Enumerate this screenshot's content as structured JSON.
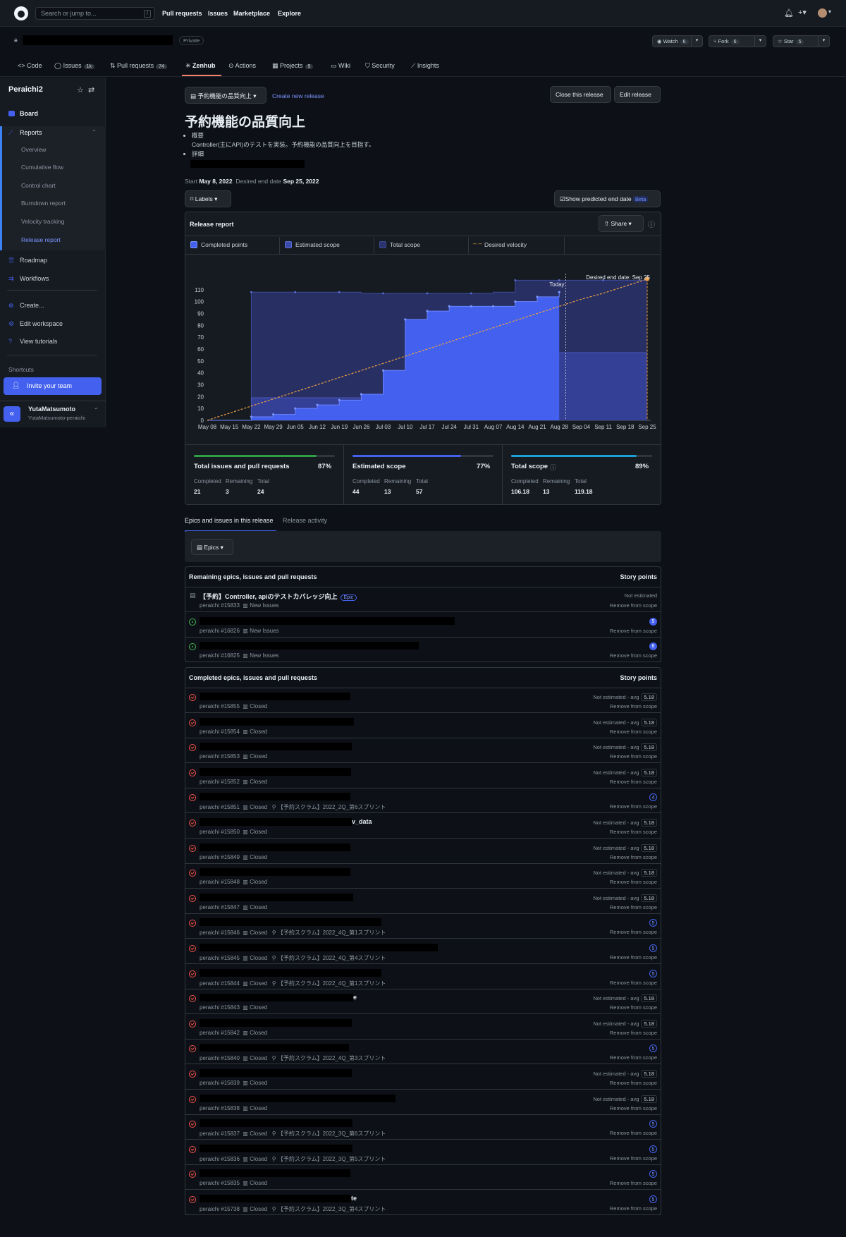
{
  "topnav": {
    "search_placeholder": "Search or jump to...",
    "slash_key": "/",
    "links": [
      "Pull requests",
      "Issues",
      "Marketplace",
      "Explore"
    ]
  },
  "repo": {
    "private_label": "Private",
    "watch": {
      "label": "Watch",
      "count": "6"
    },
    "fork": {
      "label": "Fork",
      "count": "6"
    },
    "star": {
      "label": "Star",
      "count": "5"
    }
  },
  "tabs": [
    {
      "label": "Code",
      "count": ""
    },
    {
      "label": "Issues",
      "count": "1k"
    },
    {
      "label": "Pull requests",
      "count": "74"
    },
    {
      "label": "Zenhub",
      "count": ""
    },
    {
      "label": "Actions",
      "count": ""
    },
    {
      "label": "Projects",
      "count": "9"
    },
    {
      "label": "Wiki",
      "count": ""
    },
    {
      "label": "Security",
      "count": ""
    },
    {
      "label": "Insights",
      "count": ""
    }
  ],
  "sidebar": {
    "workspace": "Peraichi2",
    "items": {
      "board": "Board",
      "reports": "Reports",
      "roadmap": "Roadmap",
      "workflows": "Workflows",
      "create": "Create...",
      "edit_workspace": "Edit workspace",
      "view_tutorials": "View tutorials"
    },
    "report_items": [
      "Overview",
      "Cumulative flow",
      "Control chart",
      "Burndown report",
      "Velocity tracking",
      "Release report"
    ],
    "shortcuts": "Shortcuts",
    "invite": "Invite your team",
    "user": {
      "name": "YutaMatsumoto",
      "login": "YutaMatsumoto-peraichi"
    }
  },
  "release": {
    "selector": "予約機能の品質向上",
    "create_new": "Create new release",
    "close_btn": "Close this release",
    "edit_btn": "Edit release",
    "title": "予約機能の品質向上",
    "bullet1": "概要",
    "bullet1_text": "Controller(主にAPI)のテストを実装。予約機能の品質向上を目指す。",
    "bullet2": "詳細",
    "start_label": "Start",
    "start_date": "May 8, 2022",
    "end_label": "Desired end date",
    "end_date": "Sep 25, 2022",
    "labels_btn": "Labels",
    "predicted_btn": "Show predicted end date",
    "beta": "Beta"
  },
  "report": {
    "title": "Release report",
    "share": "Share",
    "legend": [
      {
        "label": "Completed points",
        "color": "#4361ee"
      },
      {
        "label": "Estimated scope",
        "color": "#3a4aa8"
      },
      {
        "label": "Total scope",
        "color": "#2a336e"
      },
      {
        "label": "Desired velocity",
        "color": "#f0a040"
      }
    ]
  },
  "chart_data": {
    "type": "area",
    "x": [
      "May 08",
      "May 15",
      "May 22",
      "May 29",
      "Jun 05",
      "Jun 12",
      "Jun 19",
      "Jun 26",
      "Jul 03",
      "Jul 10",
      "Jul 17",
      "Jul 24",
      "Jul 31",
      "Aug 07",
      "Aug 14",
      "Aug 21",
      "Aug 28",
      "Sep 04",
      "Sep 11",
      "Sep 18",
      "Sep 25"
    ],
    "yticks": [
      0,
      10,
      20,
      30,
      40,
      50,
      60,
      70,
      80,
      90,
      100,
      110
    ],
    "ylim": [
      0,
      120
    ],
    "annotations": {
      "today": "Today",
      "end": "Desired end date: Sep 25"
    },
    "series": [
      {
        "name": "Completed points",
        "values": [
          0,
          0,
          3,
          5,
          10,
          13,
          17,
          22,
          42,
          85,
          92,
          96,
          96,
          96,
          100,
          104,
          108,
          null,
          null,
          null,
          null
        ]
      },
      {
        "name": "Estimated scope",
        "values": [
          0,
          0,
          19,
          19,
          19,
          19,
          19,
          22,
          36,
          36,
          36,
          36,
          40,
          40,
          57,
          57,
          57,
          57,
          57,
          57,
          57
        ]
      },
      {
        "name": "Total scope",
        "values": [
          0,
          0,
          108,
          108,
          108,
          108,
          108,
          107,
          107,
          107,
          107,
          107,
          107,
          108,
          118,
          118,
          118,
          118,
          118,
          118,
          119
        ]
      },
      {
        "name": "Desired velocity",
        "values": [
          0,
          6,
          12,
          18,
          24,
          30,
          36,
          42,
          48,
          54,
          60,
          66,
          72,
          78,
          84,
          90,
          96,
          102,
          107,
          113,
          119
        ]
      }
    ]
  },
  "stats": [
    {
      "title": "Total issues and pull requests",
      "pct": "87%",
      "completed": "21",
      "remaining": "3",
      "total": "24",
      "fill": 0.87,
      "color": "#2ea043"
    },
    {
      "title": "Estimated scope",
      "pct": "77%",
      "completed": "44",
      "remaining": "13",
      "total": "57",
      "fill": 0.77,
      "color": "#4361ee"
    },
    {
      "title": "Total scope",
      "pct": "89%",
      "completed": "106.18",
      "remaining": "13",
      "total": "119.18",
      "fill": 0.89,
      "color": "#1f9fd8"
    }
  ],
  "stat_labels": {
    "completed": "Completed",
    "remaining": "Remaining",
    "total": "Total"
  },
  "lower_tabs": {
    "epics": "Epics and issues in this release",
    "activity": "Release activity"
  },
  "epics_btn": "Epics",
  "remaining": {
    "header": "Remaining epics, issues and pull requests",
    "points_header": "Story points",
    "rows": [
      {
        "title": "【予約】Controller, apiのテストカバレッジ向上",
        "epic": "Epic",
        "num": "peraichi #15833",
        "pipeline": "New Issues",
        "pts": "Not estimated",
        "remove": "Remove from scope"
      },
      {
        "title": "",
        "num": "peraichi #16826",
        "pipeline": "New Issues",
        "circle": "5",
        "remove": "Remove from scope"
      },
      {
        "title": "",
        "num": "peraichi #16825",
        "pipeline": "New Issues",
        "circle": "8",
        "remove": "Remove from scope"
      }
    ]
  },
  "completed": {
    "header": "Completed epics, issues and pull requests",
    "points_header": "Story points",
    "not_est": "Not estimated - avg",
    "avg": "5.18",
    "closed": "Closed",
    "remove": "Remove from scope",
    "rows": [
      {
        "num": "peraichi #15855",
        "tail": "",
        "sprint": "",
        "circle": ""
      },
      {
        "num": "peraichi #15854",
        "tail": "",
        "sprint": "",
        "circle": ""
      },
      {
        "num": "peraichi #15853",
        "tail": "",
        "sprint": "",
        "circle": ""
      },
      {
        "num": "peraichi #15852",
        "tail": "",
        "sprint": "",
        "circle": ""
      },
      {
        "num": "peraichi #15851",
        "tail": "",
        "sprint": "【予約スクラム】2022_2Q_第6スプリント",
        "circle": "4"
      },
      {
        "num": "peraichi #15850",
        "tail": "v_data",
        "sprint": "",
        "circle": ""
      },
      {
        "num": "peraichi #15849",
        "tail": "",
        "sprint": "",
        "circle": ""
      },
      {
        "num": "peraichi #15848",
        "tail": "",
        "sprint": "",
        "circle": ""
      },
      {
        "num": "peraichi #15847",
        "tail": "",
        "sprint": "",
        "circle": ""
      },
      {
        "num": "peraichi #15846",
        "tail": "",
        "sprint": "【予約スクラム】2022_4Q_第1スプリント",
        "circle": "5"
      },
      {
        "num": "peraichi #15845",
        "tail": "",
        "sprint": "【予約スクラム】2022_4Q_第4スプリント",
        "circle": "5"
      },
      {
        "num": "peraichi #15844",
        "tail": "",
        "sprint": "【予約スクラム】2022_4Q_第1スプリント",
        "circle": "5"
      },
      {
        "num": "peraichi #15843",
        "tail": "e",
        "sprint": "",
        "circle": ""
      },
      {
        "num": "peraichi #15842",
        "tail": "",
        "sprint": "",
        "circle": ""
      },
      {
        "num": "peraichi #15840",
        "tail": "",
        "sprint": "【予約スクラム】2022_4Q_第3スプリント",
        "circle": "5"
      },
      {
        "num": "peraichi #15839",
        "tail": "",
        "sprint": "",
        "circle": ""
      },
      {
        "num": "peraichi #15838",
        "tail": "",
        "sprint": "",
        "circle": ""
      },
      {
        "num": "peraichi #15837",
        "tail": "",
        "sprint": "【予約スクラム】2022_3Q_第6スプリント",
        "circle": "5"
      },
      {
        "num": "peraichi #15836",
        "tail": "",
        "sprint": "【予約スクラム】2022_3Q_第5スプリント",
        "circle": "5"
      },
      {
        "num": "peraichi #15835",
        "tail": "",
        "sprint": "",
        "circle": "5"
      },
      {
        "num": "peraichi #15738",
        "tail": "te",
        "sprint": "【予約スクラム】2022_3Q_第4スプリント",
        "circle": "5"
      }
    ]
  }
}
